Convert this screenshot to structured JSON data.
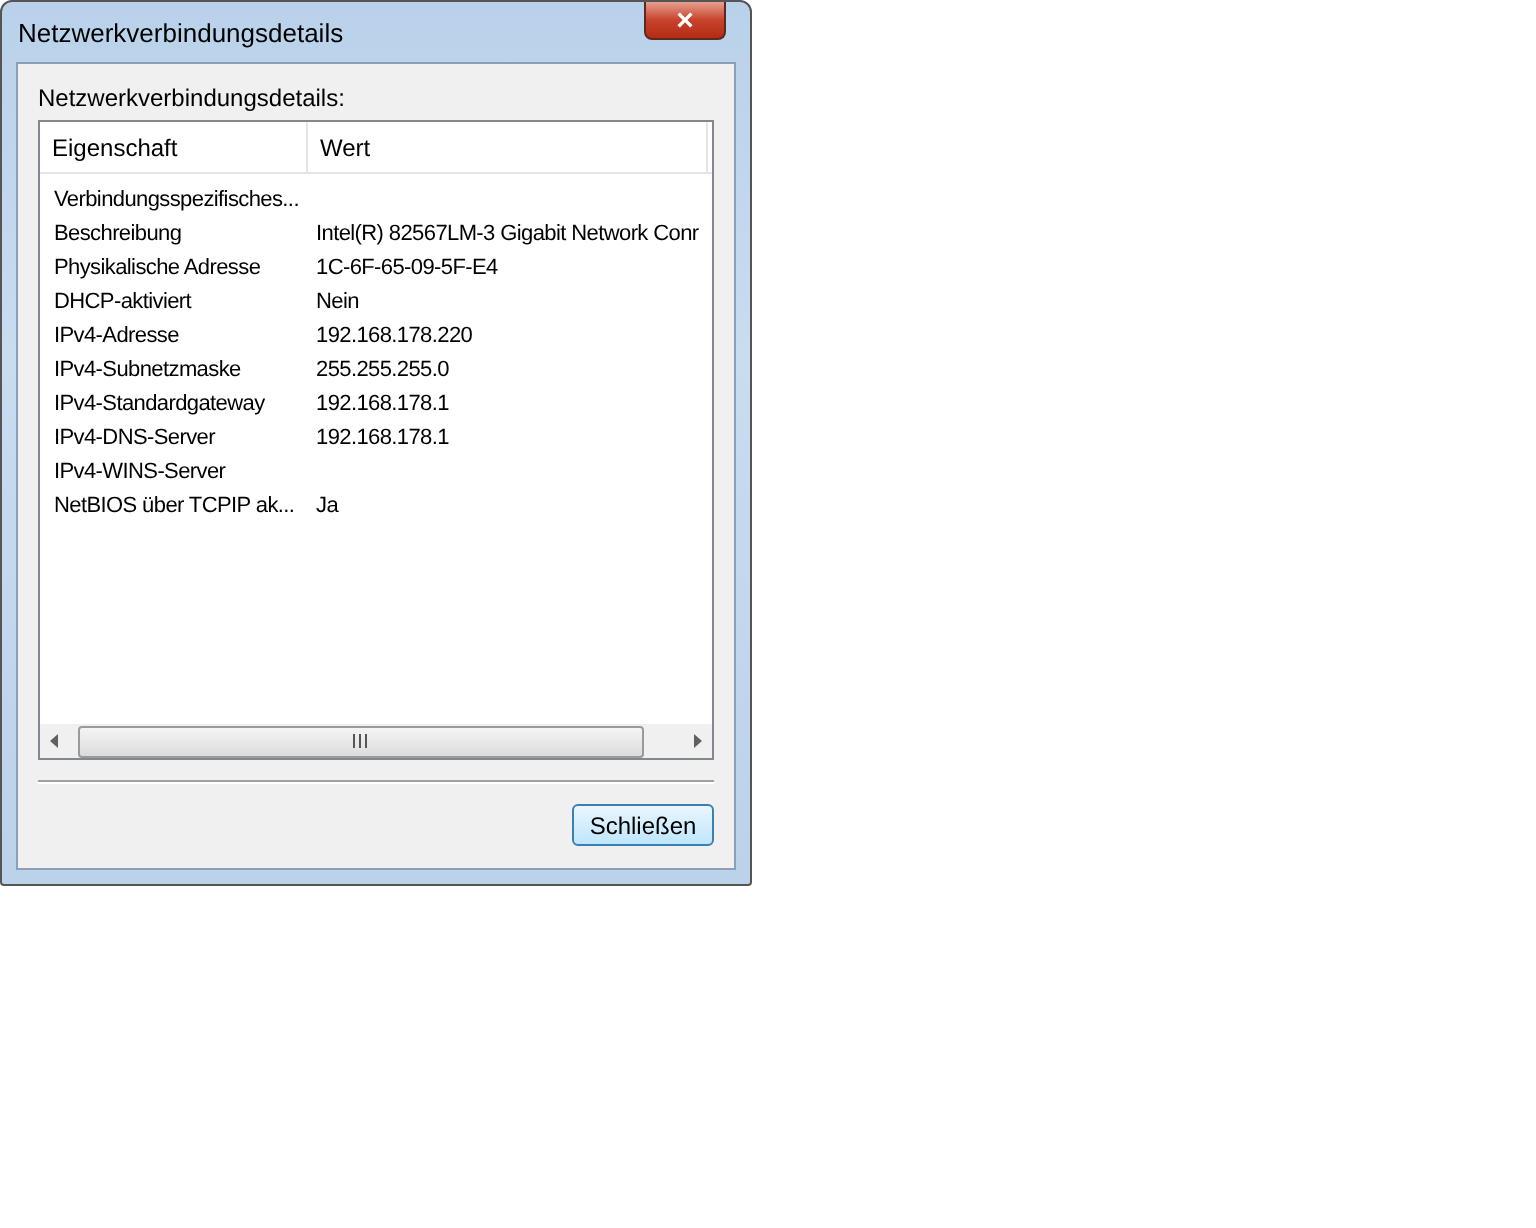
{
  "window": {
    "title": "Netzwerkverbindungsdetails",
    "close": "×"
  },
  "label": "Netzwerkverbindungsdetails:",
  "table": {
    "columns": [
      "Eigenschaft",
      "Wert"
    ],
    "rows": [
      {
        "property": "Verbindungsspezifisches...",
        "value": ""
      },
      {
        "property": "Beschreibung",
        "value": "Intel(R) 82567LM-3 Gigabit Network Conr"
      },
      {
        "property": "Physikalische Adresse",
        "value": "1C-6F-65-09-5F-E4"
      },
      {
        "property": "DHCP-aktiviert",
        "value": "Nein"
      },
      {
        "property": "IPv4-Adresse",
        "value": "192.168.178.220"
      },
      {
        "property": "IPv4-Subnetzmaske",
        "value": "255.255.255.0"
      },
      {
        "property": "IPv4-Standardgateway",
        "value": "192.168.178.1"
      },
      {
        "property": "IPv4-DNS-Server",
        "value": "192.168.178.1"
      },
      {
        "property": "IPv4-WINS-Server",
        "value": ""
      },
      {
        "property": "NetBIOS über TCPIP ak...",
        "value": "Ja"
      }
    ]
  },
  "buttons": [
    "Schließen"
  ]
}
